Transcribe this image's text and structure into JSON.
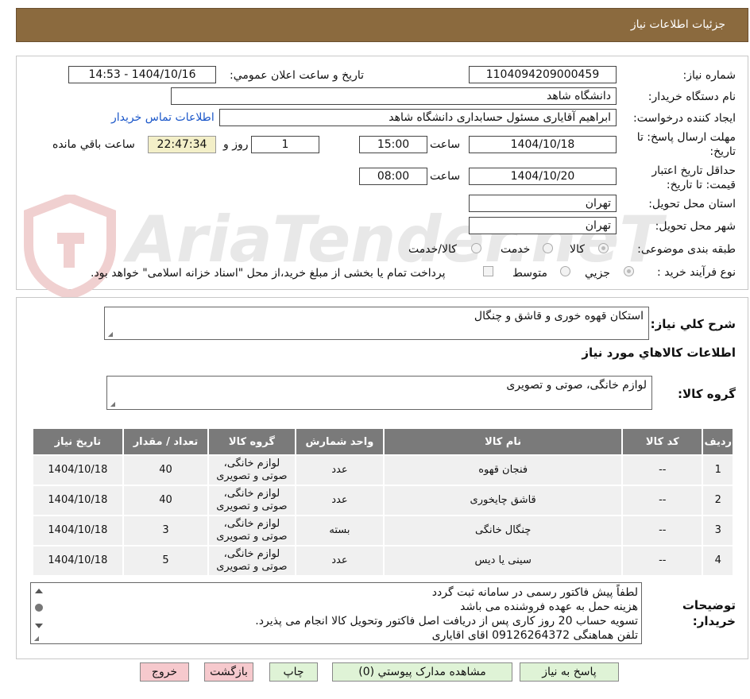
{
  "header": {
    "title": "جزئيات اطلاعات نياز"
  },
  "watermark": "AriaTender.neT",
  "form": {
    "need_number_label": "شماره نياز:",
    "need_number": "1104094209000459",
    "announce_label": "تاريخ و ساعت اعلان عمومي:",
    "announce_value": "1404/10/16 - 14:53",
    "buyer_org_label": "نام دستگاه خريدار:",
    "buyer_org": "دانشگاه شاهد",
    "creator_label": "ايجاد کننده درخواست:",
    "creator": "ابراهیم آقایاری مسئول حسابداری دانشگاه شاهد",
    "contact_link": "اطلاعات تماس خريدار",
    "deadline_label": "مهلت ارسال پاسخ: تا تاريخ:",
    "deadline_date": "1404/10/18",
    "time_label": "ساعت",
    "deadline_time": "15:00",
    "days_value": "1",
    "days_label": "روز و",
    "remaining_time": "22:47:34",
    "remaining_label": "ساعت باقي مانده",
    "validity_label": "حداقل تاريخ اعتبار قيمت: تا تاريخ:",
    "validity_date": "1404/10/20",
    "validity_time_label": "ساعت",
    "validity_time": "08:00",
    "province_label": "استان محل تحويل:",
    "province": "تهران",
    "city_label": "شهر محل تحويل:",
    "city": "تهران",
    "category_label": "طبقه بندی موضوعی:",
    "category_options": [
      "کالا",
      "خدمت",
      "کالا/خدمت"
    ],
    "process_label": "نوع فرآيند خريد :",
    "process_options": [
      "جزيي",
      "متوسط"
    ],
    "payment_note": "پرداخت تمام يا بخشی از مبلغ خريد،از محل \"اسناد خزانه اسلامی\" خواهد بود."
  },
  "summary": {
    "description_label": "شرح کلي نياز:",
    "description": "استکان قهوه خوری و قاشق و چنگال",
    "goods_info_title": "اطلاعات کالاهاي مورد نياز",
    "goods_group_label": "گروه کالا:",
    "goods_group": "لوازم خانگی، صوتی و تصویری"
  },
  "table": {
    "headers": [
      "رديف",
      "کد کالا",
      "نام کالا",
      "واحد شمارش",
      "گروه کالا",
      "تعداد / مقدار",
      "تاريخ نياز"
    ],
    "rows": [
      [
        "1",
        "--",
        "فنجان قهوه",
        "عدد",
        "لوازم خانگی، صوتی و تصویری",
        "40",
        "1404/10/18"
      ],
      [
        "2",
        "--",
        "قاشق چایخوری",
        "عدد",
        "لوازم خانگی، صوتی و تصویری",
        "40",
        "1404/10/18"
      ],
      [
        "3",
        "--",
        "چنگال خانگی",
        "بسته",
        "لوازم خانگی، صوتی و تصویری",
        "3",
        "1404/10/18"
      ],
      [
        "4",
        "--",
        "سینی یا دیس",
        "عدد",
        "لوازم خانگی، صوتی و تصویری",
        "5",
        "1404/10/18"
      ]
    ]
  },
  "notes": {
    "label": "توضيحات خريدار:",
    "lines": [
      "لطفاً پیش فاکتور رسمی در سامانه ثبت گردد",
      "هزینه حمل به عهده فروشنده می باشد",
      "تسویه حساب 20 روز کاری پس از دریافت اصل فاکتور وتحویل کالا انجام می پذیرد.",
      "تلفن هماهنگی 09126264372 اقای اقایاری"
    ]
  },
  "buttons": {
    "reply": "پاسخ به نياز",
    "attachments": "مشاهده مدارک پيوستي (0)",
    "print": "چاپ",
    "back": "بازگشت",
    "exit": "خروج"
  }
}
